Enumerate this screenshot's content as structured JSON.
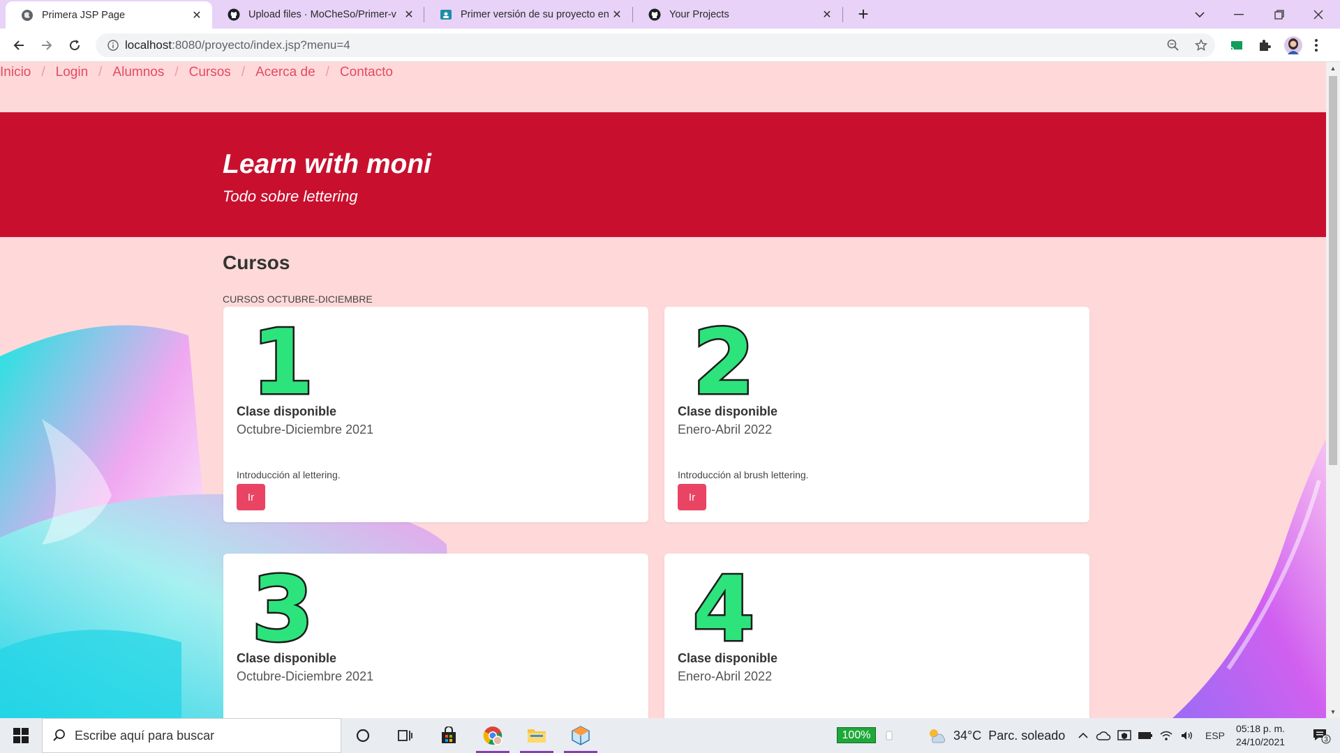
{
  "browser": {
    "tabs": [
      {
        "title": "Primera JSP Page",
        "active": true
      },
      {
        "title": "Upload files · MoCheSo/Primer-v",
        "active": false
      },
      {
        "title": "Primer versión de su proyecto en",
        "active": false
      },
      {
        "title": "Your Projects",
        "active": false
      }
    ],
    "url_host": "localhost",
    "url_rest": ":8080/proyecto/index.jsp?menu=4"
  },
  "page": {
    "breadcrumb": [
      "Inicio",
      "Login",
      "Alumnos",
      "Cursos",
      "Acerca de",
      "Contacto"
    ],
    "separator": "/",
    "hero_title": "Learn with moni",
    "hero_subtitle": "Todo sobre lettering",
    "section_title": "Cursos",
    "section_caption": "CURSOS OCTUBRE-DICIEMBRE",
    "cards": [
      {
        "number": "1",
        "title": "Clase disponible",
        "date": "Octubre-Diciembre 2021",
        "desc": "Introducción al lettering.",
        "button": "Ir"
      },
      {
        "number": "2",
        "title": "Clase disponible",
        "date": "Enero-Abril 2022",
        "desc": "Introducción al brush lettering.",
        "button": "Ir"
      },
      {
        "number": "3",
        "title": "Clase disponible",
        "date": "Octubre-Diciembre 2021"
      },
      {
        "number": "4",
        "title": "Clase disponible",
        "date": "Enero-Abril 2022"
      }
    ],
    "colors": {
      "hero": "#c8102e",
      "background": "#ffd9d9",
      "accent": "#ea4464",
      "numbers": "#2de37c"
    }
  },
  "taskbar": {
    "search_placeholder": "Escribe aquí para buscar",
    "battery": "100%",
    "weather_temp": "34°C",
    "weather_text": "Parc. soleado",
    "language": "ESP",
    "time": "05:18 p. m.",
    "date": "24/10/2021",
    "notifications": "3"
  }
}
